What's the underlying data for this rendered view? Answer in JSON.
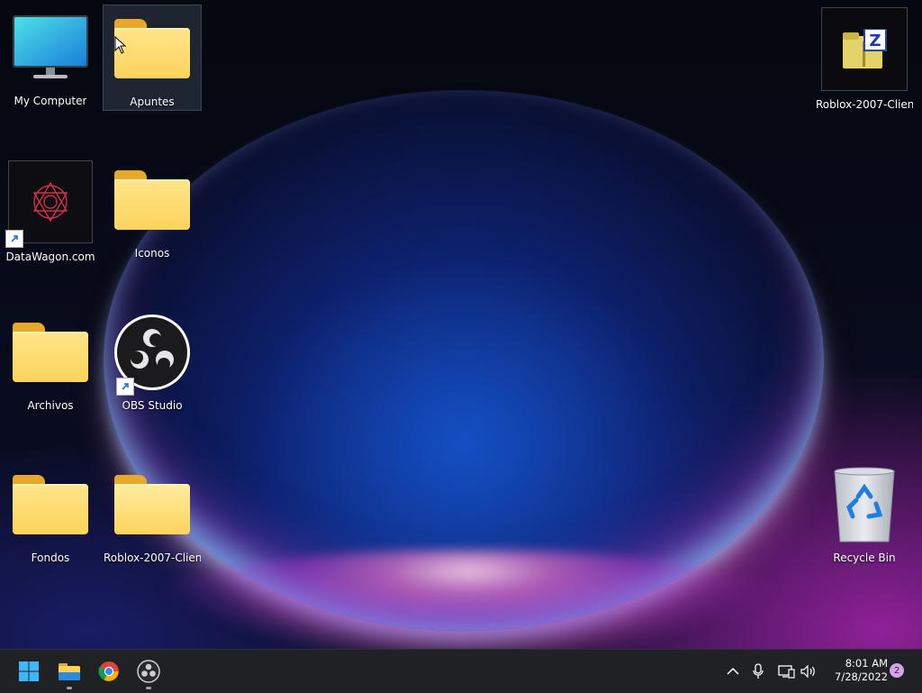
{
  "desktop_icons": {
    "my_computer": "My Computer",
    "apuntes": "Apuntes",
    "roblox_zip": "Roblox-2007-Clien...",
    "datawagon": "DataWagon.com",
    "iconos": "Iconos",
    "archivos": "Archivos",
    "obs": "OBS Studio",
    "fondos": "Fondos",
    "roblox_folder": "Roblox-2007-Clien...",
    "recycle_bin": "Recycle Bin"
  },
  "taskbar": {
    "pinned": [
      "start-icon",
      "file-explorer-icon",
      "chrome-icon",
      "obs-icon"
    ],
    "tray": [
      "chevron-up-icon",
      "microphone-icon",
      "network-icon",
      "volume-icon"
    ],
    "time": "8:01 AM",
    "date": "7/28/2022",
    "notification_count": "2"
  },
  "colors": {
    "taskbar_bg": "#202124",
    "folder_yellow": "#fcd35c",
    "accent_blue": "#1e78ff",
    "accent_magenta": "#c828c8"
  }
}
